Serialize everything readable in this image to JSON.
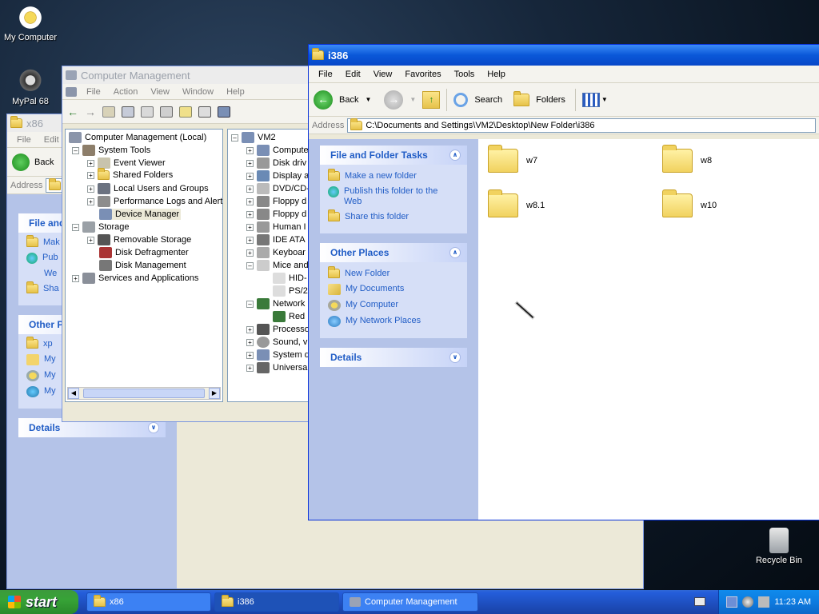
{
  "desktop": {
    "icons": [
      {
        "label": "My Computer"
      },
      {
        "label": "MyPal 68"
      },
      {
        "label": "Recycle Bin"
      }
    ]
  },
  "x86_window": {
    "title": "x86",
    "menu": [
      "File",
      "Edit"
    ],
    "back_label": "Back",
    "address_label": "Address",
    "file_tasks_head": "File and",
    "file_tasks": [
      "Mak",
      "Pub",
      "We",
      "Sha"
    ],
    "other_head": "Other P",
    "other_items": [
      "xp",
      "My",
      "My",
      "My"
    ],
    "details_head": "Details"
  },
  "comp_mgmt": {
    "title": "Computer Management",
    "menu": [
      "File",
      "Action",
      "View",
      "Window",
      "Help"
    ],
    "tree": [
      "Computer Management (Local)",
      "System Tools",
      "Event Viewer",
      "Shared Folders",
      "Local Users and Groups",
      "Performance Logs and Alerts",
      "Device Manager",
      "Storage",
      "Removable Storage",
      "Disk Defragmenter",
      "Disk Management",
      "Services and Applications"
    ],
    "devices": [
      "VM2",
      "Compute",
      "Disk driv",
      "Display a",
      "DVD/CD-",
      "Floppy d",
      "Floppy d",
      "Human I",
      "IDE ATA",
      "Keyboar",
      "Mice and",
      "HID-",
      "PS/2",
      "Network",
      "Red",
      "Processo",
      "Sound, v",
      "System d",
      "Universa"
    ]
  },
  "i386_window": {
    "title": "i386",
    "menu": [
      "File",
      "Edit",
      "View",
      "Favorites",
      "Tools",
      "Help"
    ],
    "toolbar": {
      "back": "Back",
      "search": "Search",
      "folders": "Folders"
    },
    "address_label": "Address",
    "address": "C:\\Documents and Settings\\VM2\\Desktop\\New Folder\\i386",
    "file_tasks": {
      "title": "File and Folder Tasks",
      "items": [
        "Make a new folder",
        "Publish this folder to the Web",
        "Share this folder"
      ]
    },
    "other_places": {
      "title": "Other Places",
      "items": [
        "New Folder",
        "My Documents",
        "My Computer",
        "My Network Places"
      ]
    },
    "details": {
      "title": "Details"
    },
    "folders": [
      "w7",
      "w8",
      "w8.1",
      "w10"
    ]
  },
  "taskbar": {
    "start": "start",
    "buttons": [
      "x86",
      "i386",
      "Computer Management"
    ],
    "clock": "11:23 AM"
  }
}
